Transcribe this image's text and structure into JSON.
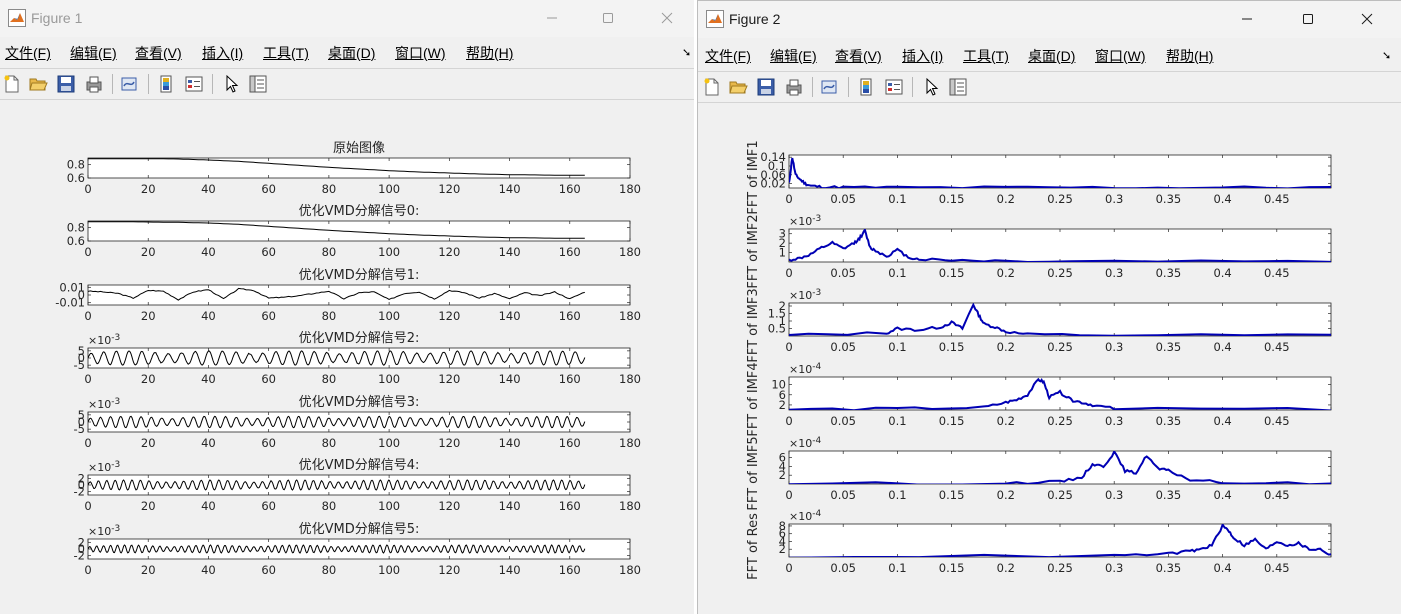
{
  "colors": {
    "trace_black": "#000000",
    "trace_blue": "#0000b4",
    "window_bg": "#f0f0f0"
  },
  "figure1": {
    "title": "Figure 1",
    "menu": [
      "文件(F)",
      "编辑(E)",
      "查看(V)",
      "插入(I)",
      "工具(T)",
      "桌面(D)",
      "窗口(W)",
      "帮助(H)"
    ],
    "toolbar_icons": [
      "new-figure-icon",
      "open-folder-icon",
      "save-icon",
      "print-icon",
      "link-plot-icon",
      "colorbar-icon",
      "legend-icon",
      "pointer-icon",
      "property-editor-icon"
    ],
    "x_ticks": [
      "0",
      "20",
      "40",
      "60",
      "80",
      "100",
      "120",
      "140",
      "160",
      "180"
    ],
    "subplots": [
      {
        "title": "原始图像",
        "yticks": [
          "0.8",
          "0.6"
        ],
        "exponent": ""
      },
      {
        "title": "优化VMD分解信号0:",
        "yticks": [
          "0.8",
          "0.6"
        ],
        "exponent": ""
      },
      {
        "title": "优化VMD分解信号1:",
        "yticks": [
          "0.01",
          "0",
          "-0.01"
        ],
        "exponent": ""
      },
      {
        "title": "优化VMD分解信号2:",
        "yticks": [
          "5",
          "0",
          "-5"
        ],
        "exponent": "×10",
        "exponent_power": "-3"
      },
      {
        "title": "优化VMD分解信号3:",
        "yticks": [
          "5",
          "0",
          "-5"
        ],
        "exponent": "×10",
        "exponent_power": "-3"
      },
      {
        "title": "优化VMD分解信号4:",
        "yticks": [
          "2",
          "0",
          "-2"
        ],
        "exponent": "×10",
        "exponent_power": "-3"
      },
      {
        "title": "优化VMD分解信号5:",
        "yticks": [
          "2",
          "0",
          "-2"
        ],
        "exponent": "×10",
        "exponent_power": "-3"
      }
    ]
  },
  "figure2": {
    "title": "Figure 2",
    "menu": [
      "文件(F)",
      "编辑(E)",
      "查看(V)",
      "插入(I)",
      "工具(T)",
      "桌面(D)",
      "窗口(W)",
      "帮助(H)"
    ],
    "toolbar_icons": [
      "new-figure-icon",
      "open-folder-icon",
      "save-icon",
      "print-icon",
      "link-plot-icon",
      "colorbar-icon",
      "legend-icon",
      "pointer-icon",
      "property-editor-icon"
    ],
    "x_ticks": [
      "0",
      "0.05",
      "0.1",
      "0.15",
      "0.2",
      "0.25",
      "0.3",
      "0.35",
      "0.4",
      "0.45"
    ],
    "subplots": [
      {
        "ylabel": "FFT of IMF1",
        "yticks": [
          "0.14",
          "0.1",
          "0.06",
          "0.02"
        ],
        "exponent": ""
      },
      {
        "ylabel": "FFT of IMF2",
        "yticks": [
          "3",
          "2",
          "1"
        ],
        "exponent": "×10",
        "exponent_power": "-3"
      },
      {
        "ylabel": "FFT of IMF3",
        "yticks": [
          "2",
          "1.5",
          "1",
          "0.5"
        ],
        "exponent": "×10",
        "exponent_power": "-3"
      },
      {
        "ylabel": "FFT of IMF4",
        "yticks": [
          "10",
          "6",
          "2"
        ],
        "exponent": "×10",
        "exponent_power": "-4"
      },
      {
        "ylabel": "FFT of IMF5",
        "yticks": [
          "6",
          "4",
          "2"
        ],
        "exponent": "×10",
        "exponent_power": "-4"
      },
      {
        "ylabel": "FFT of Res",
        "yticks": [
          "8",
          "6",
          "4",
          "2"
        ],
        "exponent": "×10",
        "exponent_power": "-4"
      }
    ]
  },
  "chart_data": [
    {
      "type": "line",
      "title": "原始图像",
      "xlim": [
        0,
        180
      ],
      "ylim": [
        0.6,
        0.9
      ],
      "series": [
        {
          "x": [
            0,
            10,
            20,
            30,
            40,
            50,
            60,
            70,
            80,
            90,
            100,
            110,
            120,
            130,
            140,
            150,
            160,
            165
          ],
          "values": [
            0.89,
            0.89,
            0.89,
            0.885,
            0.87,
            0.85,
            0.82,
            0.79,
            0.76,
            0.735,
            0.71,
            0.69,
            0.675,
            0.66,
            0.65,
            0.645,
            0.64,
            0.64
          ]
        }
      ]
    },
    {
      "type": "line",
      "title": "优化VMD分解信号0:",
      "xlim": [
        0,
        180
      ],
      "ylim": [
        0.6,
        0.9
      ],
      "series": [
        {
          "x": [
            0,
            10,
            20,
            30,
            40,
            50,
            60,
            70,
            80,
            90,
            100,
            110,
            120,
            130,
            140,
            150,
            160,
            165
          ],
          "values": [
            0.89,
            0.89,
            0.885,
            0.88,
            0.87,
            0.85,
            0.82,
            0.79,
            0.76,
            0.735,
            0.71,
            0.69,
            0.675,
            0.66,
            0.65,
            0.645,
            0.64,
            0.64
          ]
        }
      ]
    },
    {
      "type": "line",
      "title": "优化VMD分解信号1:",
      "xlim": [
        0,
        180
      ],
      "ylim": [
        -0.013,
        0.013
      ],
      "series": [
        {
          "x": [
            0,
            5,
            10,
            15,
            20,
            25,
            30,
            35,
            40,
            45,
            50,
            55,
            60,
            65,
            70,
            75,
            80,
            85,
            90,
            95,
            100,
            105,
            110,
            115,
            120,
            125,
            130,
            135,
            140,
            145,
            150,
            155,
            160,
            165
          ],
          "values": [
            0.005,
            0.004,
            0.002,
            -0.004,
            0.006,
            0.005,
            -0.006,
            0.004,
            0.007,
            -0.005,
            0.008,
            0.006,
            -0.004,
            -0.003,
            -0.001,
            0.002,
            0.005,
            -0.005,
            0.003,
            0.004,
            -0.006,
            0.002,
            0.004,
            -0.005,
            0.006,
            0.003,
            -0.004,
            0.002,
            -0.005,
            0.003,
            -0.001,
            0.004,
            -0.005,
            0.004
          ]
        }
      ]
    },
    {
      "type": "line",
      "title": "优化VMD分解信号2:",
      "xlim": [
        0,
        180
      ],
      "ylim": [
        -0.007,
        0.007
      ],
      "series": [
        {
          "x_max": 165,
          "approx_cycles": 38,
          "amplitude": 0.005
        }
      ]
    },
    {
      "type": "line",
      "title": "优化VMD分解信号3:",
      "xlim": [
        0,
        180
      ],
      "ylim": [
        -0.007,
        0.007
      ],
      "series": [
        {
          "x_max": 165,
          "approx_cycles": 48,
          "amplitude": 0.004
        }
      ]
    },
    {
      "type": "line",
      "title": "优化VMD分解信号4:",
      "xlim": [
        0,
        180
      ],
      "ylim": [
        -0.003,
        0.003
      ],
      "series": [
        {
          "x_max": 165,
          "approx_cycles": 58,
          "amplitude": 0.0015
        }
      ]
    },
    {
      "type": "line",
      "title": "优化VMD分解信号5:",
      "xlim": [
        0,
        180
      ],
      "ylim": [
        -0.003,
        0.003
      ],
      "series": [
        {
          "x_max": 165,
          "approx_cycles": 70,
          "amplitude": 0.0012
        }
      ]
    },
    {
      "type": "line",
      "ylabel": "FFT of IMF1",
      "xlim": [
        0,
        0.5
      ],
      "ylim": [
        0,
        0.15
      ],
      "series": [
        {
          "x": [
            0,
            0.003,
            0.006,
            0.01,
            0.015,
            0.02,
            0.03,
            0.05,
            0.1,
            0.2,
            0.3,
            0.4,
            0.5
          ],
          "values": [
            0.02,
            0.14,
            0.06,
            0.04,
            0.02,
            0.01,
            0.005,
            0.003,
            0.002,
            0.002,
            0.002,
            0.002,
            0.002
          ]
        }
      ]
    },
    {
      "type": "line",
      "ylabel": "FFT of IMF2",
      "xlim": [
        0,
        0.5
      ],
      "ylim": [
        0,
        0.0035
      ],
      "series": [
        {
          "x": [
            0,
            0.01,
            0.02,
            0.03,
            0.04,
            0.05,
            0.06,
            0.065,
            0.07,
            0.075,
            0.08,
            0.09,
            0.1,
            0.11,
            0.12,
            0.15,
            0.2,
            0.3,
            0.5
          ],
          "values": [
            0.0002,
            0.0004,
            0.0008,
            0.0015,
            0.002,
            0.0014,
            0.002,
            0.0025,
            0.0033,
            0.0015,
            0.0012,
            0.0006,
            0.0013,
            0.0005,
            0.0003,
            0.0002,
            0.0001,
            0.0001,
            0.0001
          ]
        }
      ]
    },
    {
      "type": "line",
      "ylabel": "FFT of IMF3",
      "xlim": [
        0,
        0.5
      ],
      "ylim": [
        0,
        0.0022
      ],
      "series": [
        {
          "x": [
            0,
            0.09,
            0.1,
            0.12,
            0.14,
            0.15,
            0.16,
            0.17,
            0.175,
            0.18,
            0.19,
            0.2,
            0.22,
            0.3,
            0.5
          ],
          "values": [
            5e-05,
            0.0002,
            0.0005,
            0.0004,
            0.0006,
            0.0009,
            0.0005,
            0.0021,
            0.0014,
            0.0008,
            0.0006,
            0.0003,
            0.0001,
            5e-05,
            5e-05
          ]
        }
      ]
    },
    {
      "type": "line",
      "ylabel": "FFT of IMF4",
      "xlim": [
        0,
        0.5
      ],
      "ylim": [
        0,
        0.0013
      ],
      "series": [
        {
          "x": [
            0,
            0.1,
            0.18,
            0.2,
            0.21,
            0.22,
            0.23,
            0.235,
            0.24,
            0.25,
            0.26,
            0.27,
            0.28,
            0.3,
            0.5
          ],
          "values": [
            2e-05,
            5e-05,
            0.0001,
            0.0003,
            0.0004,
            0.0006,
            0.0012,
            0.0011,
            0.0005,
            0.0007,
            0.0004,
            0.0003,
            0.0002,
            5e-05,
            2e-05
          ]
        }
      ]
    },
    {
      "type": "line",
      "ylabel": "FFT of IMF5",
      "xlim": [
        0,
        0.5
      ],
      "ylim": [
        0,
        0.00075
      ],
      "series": [
        {
          "x": [
            0,
            0.2,
            0.25,
            0.27,
            0.28,
            0.29,
            0.3,
            0.31,
            0.32,
            0.33,
            0.34,
            0.35,
            0.37,
            0.4,
            0.5
          ],
          "values": [
            1e-05,
            2e-05,
            5e-05,
            0.00015,
            0.00045,
            0.0004,
            0.00072,
            0.0003,
            0.00025,
            0.00065,
            0.00035,
            0.0003,
            0.0001,
            3e-05,
            1e-05
          ]
        }
      ]
    },
    {
      "type": "line",
      "ylabel": "FFT of Res",
      "xlim": [
        0,
        0.5
      ],
      "ylim": [
        0,
        0.00085
      ],
      "series": [
        {
          "x": [
            0,
            0.3,
            0.35,
            0.37,
            0.38,
            0.39,
            0.4,
            0.405,
            0.41,
            0.42,
            0.43,
            0.44,
            0.45,
            0.46,
            0.47,
            0.48,
            0.49,
            0.5
          ],
          "values": [
            1e-05,
            3e-05,
            8e-05,
            0.00015,
            0.0002,
            0.0003,
            0.0008,
            0.0007,
            0.0005,
            0.0003,
            0.00045,
            0.0002,
            0.0004,
            0.0003,
            0.00035,
            0.0002,
            0.0002,
            5e-05
          ]
        }
      ]
    }
  ]
}
